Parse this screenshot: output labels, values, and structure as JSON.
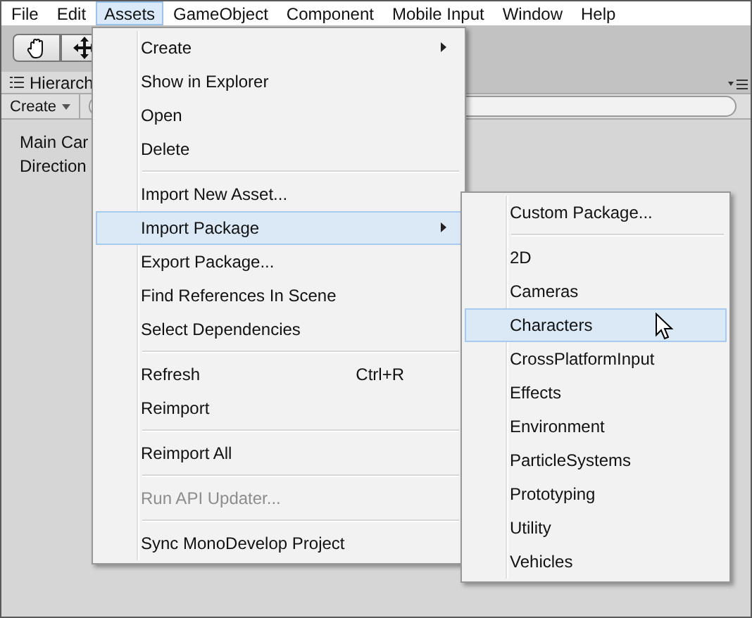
{
  "menu_bar": [
    {
      "label": "File",
      "selected": false
    },
    {
      "label": "Edit",
      "selected": false
    },
    {
      "label": "Assets",
      "selected": true
    },
    {
      "label": "GameObject",
      "selected": false
    },
    {
      "label": "Component",
      "selected": false
    },
    {
      "label": "Mobile Input",
      "selected": false
    },
    {
      "label": "Window",
      "selected": false
    },
    {
      "label": "Help",
      "selected": false
    }
  ],
  "hierarchy": {
    "tab_title": "Hierarch",
    "create_button": "Create",
    "items": [
      "Main Car",
      "Direction"
    ]
  },
  "assets_menu": [
    {
      "kind": "item",
      "label": "Create",
      "has_submenu": true,
      "selected": false,
      "disabled": false
    },
    {
      "kind": "item",
      "label": "Show in Explorer",
      "selected": false,
      "disabled": false
    },
    {
      "kind": "item",
      "label": "Open",
      "selected": false,
      "disabled": false
    },
    {
      "kind": "item",
      "label": "Delete",
      "selected": false,
      "disabled": false
    },
    {
      "kind": "separator"
    },
    {
      "kind": "item",
      "label": "Import New Asset...",
      "selected": false,
      "disabled": false
    },
    {
      "kind": "item",
      "label": "Import Package",
      "has_submenu": true,
      "selected": true,
      "disabled": false
    },
    {
      "kind": "item",
      "label": "Export Package...",
      "selected": false,
      "disabled": false
    },
    {
      "kind": "item",
      "label": "Find References In Scene",
      "selected": false,
      "disabled": false
    },
    {
      "kind": "item",
      "label": "Select Dependencies",
      "selected": false,
      "disabled": false
    },
    {
      "kind": "separator"
    },
    {
      "kind": "item",
      "label": "Refresh",
      "shortcut": "Ctrl+R",
      "selected": false,
      "disabled": false
    },
    {
      "kind": "item",
      "label": "Reimport",
      "selected": false,
      "disabled": false
    },
    {
      "kind": "separator"
    },
    {
      "kind": "item",
      "label": "Reimport All",
      "selected": false,
      "disabled": false
    },
    {
      "kind": "separator"
    },
    {
      "kind": "item",
      "label": "Run API Updater...",
      "selected": false,
      "disabled": true
    },
    {
      "kind": "separator"
    },
    {
      "kind": "item",
      "label": "Sync MonoDevelop Project",
      "selected": false,
      "disabled": false
    }
  ],
  "import_package_submenu": [
    {
      "kind": "item",
      "label": "Custom Package...",
      "selected": false
    },
    {
      "kind": "separator"
    },
    {
      "kind": "item",
      "label": "2D",
      "selected": false
    },
    {
      "kind": "item",
      "label": "Cameras",
      "selected": false
    },
    {
      "kind": "item",
      "label": "Characters",
      "selected": true
    },
    {
      "kind": "item",
      "label": "CrossPlatformInput",
      "selected": false
    },
    {
      "kind": "item",
      "label": "Effects",
      "selected": false
    },
    {
      "kind": "item",
      "label": "Environment",
      "selected": false
    },
    {
      "kind": "item",
      "label": "ParticleSystems",
      "selected": false
    },
    {
      "kind": "item",
      "label": "Prototyping",
      "selected": false
    },
    {
      "kind": "item",
      "label": "Utility",
      "selected": false
    },
    {
      "kind": "item",
      "label": "Vehicles",
      "selected": false
    }
  ]
}
